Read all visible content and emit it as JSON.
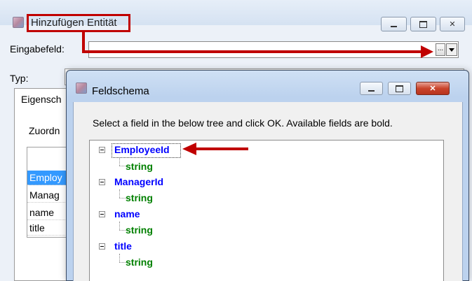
{
  "outer_window": {
    "title": "Hinzufügen Entität",
    "eingabefeld_label": "Eingabefeld:",
    "browse_button_label": "...",
    "typ_label": "Typ:",
    "tab_label": "Eigensch",
    "zuordnung_label": "Zuordn",
    "grid_rows": [
      "Employ",
      "Manag",
      "name",
      "title"
    ]
  },
  "dialog": {
    "title": "Feldschema",
    "instruction": "Select a field in the below tree and click OK. Available fields are bold.",
    "tree": [
      {
        "name": "EmployeeId",
        "type": "string"
      },
      {
        "name": "ManagerId",
        "type": "string"
      },
      {
        "name": "name",
        "type": "string"
      },
      {
        "name": "title",
        "type": "string"
      }
    ]
  },
  "colors": {
    "highlight_red": "#c00000",
    "field_blue": "#0000ff",
    "type_green": "#008000",
    "selection_blue": "#3399ff"
  }
}
